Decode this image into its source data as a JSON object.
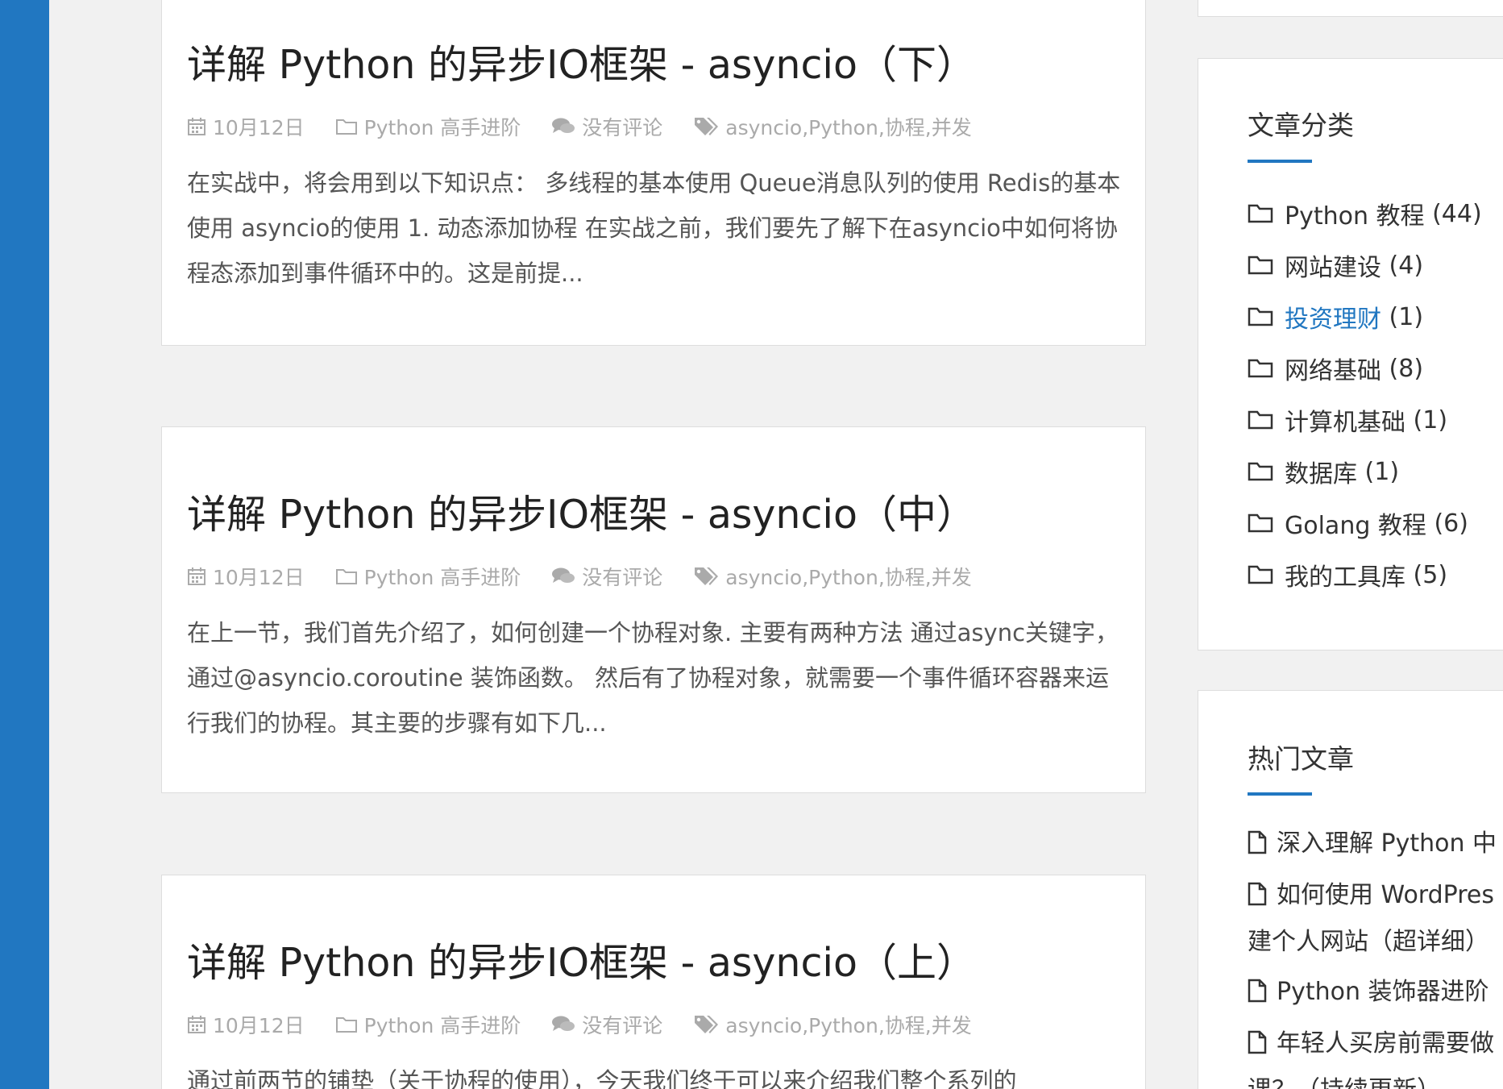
{
  "posts": [
    {
      "title": "详解 Python 的异步IO框架 - asyncio（下）",
      "date": "10月12日",
      "category": "Python 高手进阶",
      "comments": "没有评论",
      "tags": "asyncio,Python,协程,并发",
      "excerpt": "在实战中，将会用到以下知识点： 多线程的基本使用 Queue消息队列的使用 Redis的基本使用 asyncio的使用 1. 动态添加协程 在实战之前，我们要先了解下在asyncio中如何将协程态添加到事件循环中的。这是前提..."
    },
    {
      "title": "详解 Python 的异步IO框架 - asyncio（中）",
      "date": "10月12日",
      "category": "Python 高手进阶",
      "comments": "没有评论",
      "tags": "asyncio,Python,协程,并发",
      "excerpt": "在上一节，我们首先介绍了，如何创建一个协程对象. 主要有两种方法 通过async关键字， 通过@asyncio.coroutine 装饰函数。 然后有了协程对象，就需要一个事件循环容器来运行我们的协程。其主要的步骤有如下几..."
    },
    {
      "title": "详解 Python 的异步IO框架 - asyncio（上）",
      "date": "10月12日",
      "category": "Python 高手进阶",
      "comments": "没有评论",
      "tags": "asyncio,Python,协程,并发",
      "excerpt": "通过前两节的铺垫（关于协程的使用），今天我们终于可以来介绍我们整个系列的"
    }
  ],
  "categories_widget": {
    "title": "文章分类",
    "items": [
      {
        "name": "Python 教程",
        "count": "(44)"
      },
      {
        "name": "网站建设",
        "count": "(4)"
      },
      {
        "name": "投资理财",
        "count": "(1)"
      },
      {
        "name": "网络基础",
        "count": "(8)"
      },
      {
        "name": "计算机基础",
        "count": "(1)"
      },
      {
        "name": "数据库",
        "count": "(1)"
      },
      {
        "name": "Golang 教程",
        "count": "(6)"
      },
      {
        "name": "我的工具库",
        "count": "(5)"
      }
    ]
  },
  "hot_widget": {
    "title": "热门文章",
    "items": [
      "深入理解 Python 中",
      "如何使用 WordPres",
      "建个人网站（超详细）",
      "Python 装饰器进阶",
      "年轻人买房前需要做",
      "课？（持续更新）"
    ]
  },
  "colors": {
    "accent": "#2177c1",
    "meta": "#aaaaaa",
    "text": "#555555"
  }
}
